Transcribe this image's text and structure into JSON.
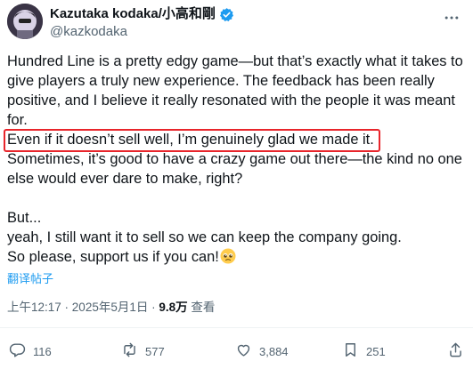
{
  "author": {
    "display_name": "Kazutaka kodaka/小高和剛",
    "handle": "@kazkodaka"
  },
  "tweet": {
    "lines": [
      "Hundred Line is a pretty edgy game—but that’s exactly what it takes to give players a truly new experience. The feedback has been really positive, and I believe it really resonated with the people it was meant for.",
      "Even if it doesn’t sell well, I’m genuinely glad we made it.",
      "Sometimes, it’s good to have a crazy game out there—the kind no one else would ever dare to make, right?",
      "But...",
      "yeah, I still want it to sell so we can keep the company going.",
      "So please, support us if you can!"
    ],
    "emoji": "pleading-face-emoji"
  },
  "translate_label": "翻译帖子",
  "meta": {
    "time": "上午12:17",
    "separator": " · ",
    "date": "2025年5月1日",
    "views": "9.8万",
    "views_label": "查看"
  },
  "actions": {
    "replies": "116",
    "reposts": "577",
    "likes": "3,884",
    "bookmarks": "251"
  },
  "colors": {
    "highlight": "#e8252b",
    "link": "#1d9bf0",
    "verified": "#1d9bf0",
    "muted": "#536471"
  }
}
